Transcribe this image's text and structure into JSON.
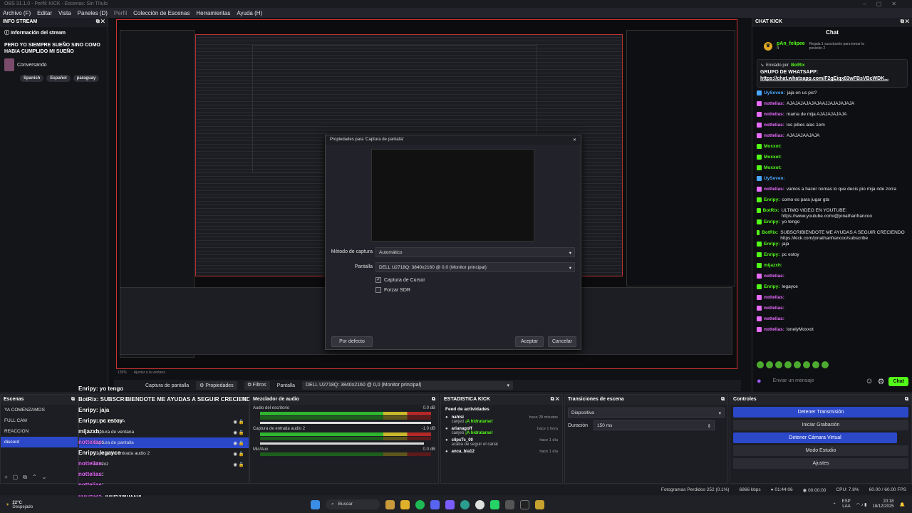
{
  "window": {
    "title": "OBS 31.1.0 - Perfil: KICK - Escenas: Sin Título"
  },
  "menu": [
    "Archivo (F)",
    "Editar",
    "Vista",
    "Paneles (D)",
    "Perfil",
    "Colección de Escenas",
    "Herramientas",
    "Ayuda (H)"
  ],
  "info_dock": {
    "title": "INFO STREAM",
    "section": "Información del stream",
    "stream_title": "PERO YO SIEMPRE SUEÑO SINO COMO HABIA CUMPLIDO MI SUEÑO",
    "category": "Conversando",
    "tags": [
      "Spanish",
      "Español",
      "paraguay"
    ]
  },
  "props_dialog": {
    "title": "Propiedades para 'Captura de pantalla'",
    "method_label": "Método de captura",
    "method_value": "Automático",
    "display_label": "Pantalla",
    "display_value": "DELL U2718Q: 3840x2160 @ 0,0 (Monitor principal)",
    "cursor_label": "Captura de Cursor",
    "sdr_label": "Forzar SDR",
    "defaults_btn": "Por defecto",
    "ok_btn": "Aceptar",
    "cancel_btn": "Cancelar"
  },
  "chat_dock": {
    "title": "CHAT KICK",
    "header": "Chat",
    "leader_name": "pAn_felipee",
    "leader_rank": "4",
    "leader_desc": "Regala 1 suscripción para tomar la posición 2",
    "pinned_by": "Enviado por",
    "pinned_user": "BotRix",
    "pinned_msg": "GRUPO DE WHATSAPP:",
    "pinned_link": "https://chat.whatsapp.com/F2gEiqx83wFBsVBcWDK...",
    "input_placeholder": "Enviar un mensaje",
    "send_label": "Chat",
    "messages": [
      {
        "user": "UySeven:",
        "text": "jaja en us pio?",
        "color": "#4aa8ff"
      },
      {
        "user": "nottelias:",
        "text": "AJAJAJAJAJAJAAJJAJAJAJAJA",
        "color": "#e86cff"
      },
      {
        "user": "nottelias:",
        "text": "mama de mija AJAJAJAJAJA",
        "color": "#e86cff"
      },
      {
        "user": "nottelias:",
        "text": "los pibes alas 1em",
        "color": "#e86cff"
      },
      {
        "user": "nottelias:",
        "text": "AJAJAJAAJAJA",
        "color": "#e86cff"
      },
      {
        "user": "Moxxot:",
        "text": "",
        "color": "#53fc18"
      },
      {
        "user": "Moxxot:",
        "text": "",
        "color": "#53fc18"
      },
      {
        "user": "Moxxot:",
        "text": "",
        "color": "#53fc18"
      },
      {
        "user": "UySeven:",
        "text": "",
        "color": "#4aa8ff"
      },
      {
        "user": "nottelias:",
        "text": "vamos a hacer nomas lo que decis pio mija nde zorra",
        "color": "#e86cff"
      },
      {
        "user": "Enripy:",
        "text": "como es para jugar gta",
        "color": "#53fc18"
      },
      {
        "user": "BotRix:",
        "text": "ULTIMO VIDEO EN YOUTUBE: https://www.youtube.com/@jonathanfrancoo",
        "color": "#53fc18"
      },
      {
        "user": "Enripy:",
        "text": "yo tengo",
        "color": "#53fc18"
      },
      {
        "user": "BotRix:",
        "text": "SUBSCRIBIENDOTE ME AYUDAS A SEGUIR CRECIENDO https://kick.com/jonathanfrancoo/subscribe",
        "color": "#53fc18"
      },
      {
        "user": "Enripy:",
        "text": "jaja",
        "color": "#53fc18"
      },
      {
        "user": "Enripy:",
        "text": "pc estoy",
        "color": "#53fc18"
      },
      {
        "user": "mijazxh:",
        "text": "",
        "color": "#53fc18"
      },
      {
        "user": "nottelias:",
        "text": "",
        "color": "#e86cff"
      },
      {
        "user": "Enripy:",
        "text": "legayce",
        "color": "#53fc18"
      },
      {
        "user": "nottelias:",
        "text": "",
        "color": "#e86cff"
      },
      {
        "user": "nottelias:",
        "text": "",
        "color": "#e86cff"
      },
      {
        "user": "nottelias:",
        "text": "",
        "color": "#e86cff"
      },
      {
        "user": "nottelias:",
        "text": "lonelyMoxxot",
        "color": "#e86cff"
      }
    ]
  },
  "source_toolbar": {
    "source": "Captura de pantalla",
    "props": "Propiedades",
    "filters": "Filtros",
    "display_label": "Pantalla",
    "display_value": "DELL U2718Q: 3840x2160 @ 0,0 (Monitor principal)",
    "zoom": "135%",
    "fit": "Ajustar a la ventana"
  },
  "overlay_chat": [
    {
      "user": "Enripy",
      "text": "yo tengo"
    },
    {
      "user": "BotRix",
      "text": "SUBSCRIBIENDOTE ME AYUDAS A SEGUIR CRECIENDO https://kick.com/jonathanfrancoo/subscribe"
    },
    {
      "user": "Enripy",
      "text": "jaja"
    },
    {
      "user": "Enripy",
      "text": "pc estoy"
    },
    {
      "user": "mijazxh",
      "text": ""
    },
    {
      "user": "nottelias",
      "text": ""
    },
    {
      "user": "Enripy",
      "text": "legayce"
    },
    {
      "user": "nottelias",
      "text": ""
    },
    {
      "user": "nottelias",
      "text": ""
    },
    {
      "user": "nottelias",
      "text": ""
    },
    {
      "user": "nottelias",
      "text": "lonelyMoxxot"
    }
  ],
  "scenes": {
    "title": "Escenas",
    "items": [
      "YA COMENZAMOS",
      "FULL CAM",
      "REACCION",
      "discord"
    ],
    "selected": 3
  },
  "sources": {
    "items": [
      "SUBS DEL DIA",
      "Captura de ventana",
      "Captura de pantalla",
      "Captura de entrada audio 2",
      "Altavoz"
    ],
    "selected": 2
  },
  "mixer": {
    "title": "Mezclador de audio",
    "channels": [
      {
        "name": "Audio del escritorio",
        "db": "0.0 dB"
      },
      {
        "name": "Captura de entrada audio 2",
        "db": "-1.0 dB"
      },
      {
        "name": "Mic/Aux",
        "db": "0.0 dB"
      }
    ]
  },
  "stats": {
    "title": "ESTADISTICA KICK",
    "feed_title": "Feed de actividades",
    "items": [
      {
        "name": "nahisi",
        "action": "canjeó",
        "reward": "¡A hidratarse!",
        "when": "hace 28 minutos"
      },
      {
        "name": "arianagoff",
        "action": "canjeó",
        "reward": "¡A hidratarse!",
        "when": "hace 1 hora"
      },
      {
        "name": "clipsTc_00",
        "action": "acaba de seguir el canal",
        "reward": "",
        "when": "hace 1 día"
      },
      {
        "name": "anca_bia12",
        "action": "",
        "reward": "",
        "when": "hace 1 día"
      }
    ]
  },
  "transitions": {
    "title": "Transiciones de escena",
    "type": "Diapositiva",
    "duration_label": "Duración",
    "duration": "150 ms"
  },
  "controls": {
    "title": "Controles",
    "buttons": [
      "Detener Transmisión",
      "Iniciar Grabación",
      "Detener Cámara Virtual",
      "Modo Estudio",
      "Ajustes"
    ]
  },
  "status": {
    "dropped": "Fotogramas Perdidos 252 (0.1%)",
    "bitrate": "6866 kbps",
    "stream_time": "01:44:06",
    "rec_time": "00:00:00",
    "cpu": "CPU: 7.8%",
    "fps": "60.00 / 60.00 FPS"
  },
  "taskbar": {
    "temp": "22°C",
    "weather": "Despejado",
    "search": "Buscar",
    "lang": "ESP",
    "lang2": "LAA",
    "time": "20:18",
    "date": "18/12/2025"
  }
}
